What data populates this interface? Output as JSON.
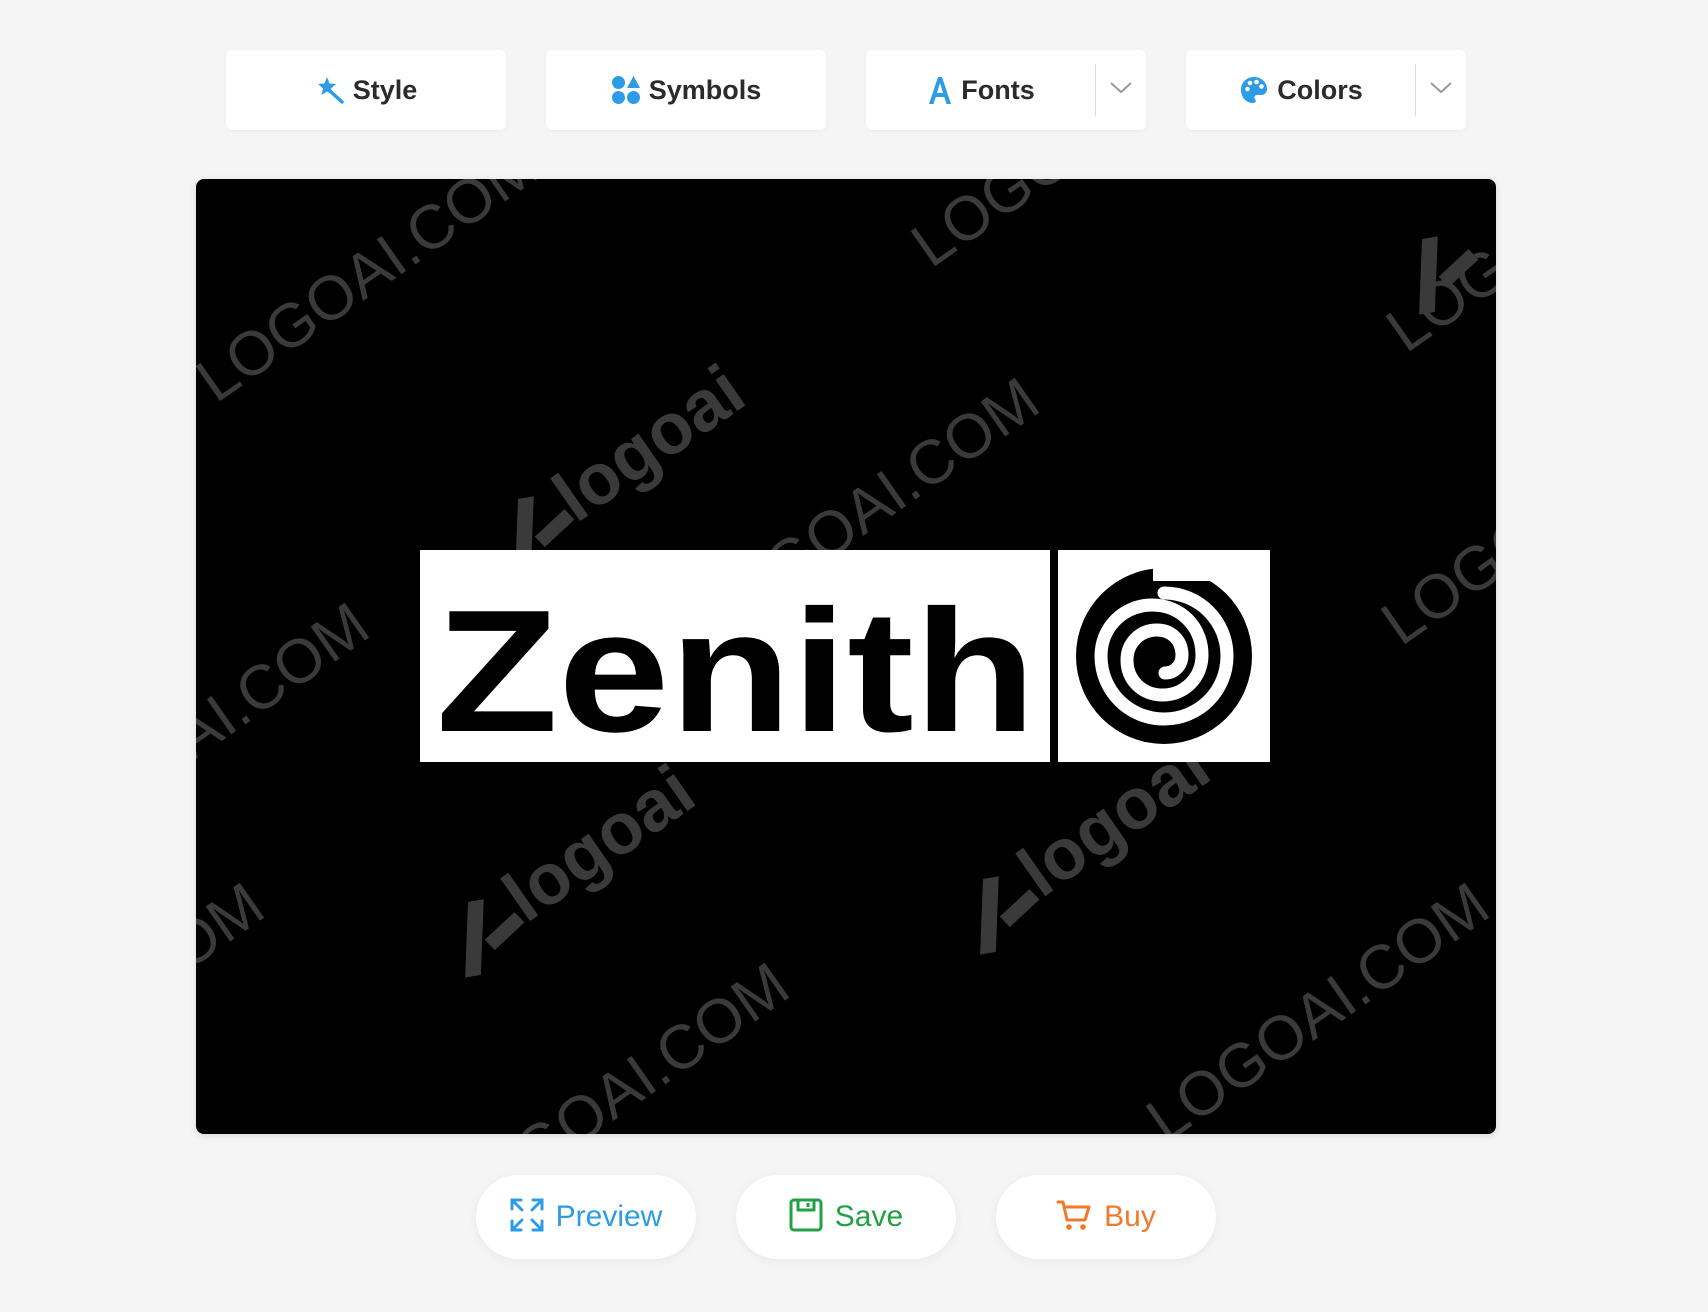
{
  "toolbar": {
    "style_label": "Style",
    "symbols_label": "Symbols",
    "fonts_label": "Fonts",
    "colors_label": "Colors"
  },
  "logo": {
    "name": "Zenith",
    "background_color": "#000000",
    "text_color": "#000000",
    "box_color": "#ffffff",
    "symbol_icon": "spiral-icon"
  },
  "watermark": {
    "domain_text": "LOGOAI.COM",
    "brand_text": "logoai"
  },
  "actions": {
    "preview_label": "Preview",
    "save_label": "Save",
    "buy_label": "Buy"
  },
  "colors": {
    "accent_blue": "#2e9be6",
    "save_green": "#22a046",
    "buy_orange": "#f07a2a"
  }
}
